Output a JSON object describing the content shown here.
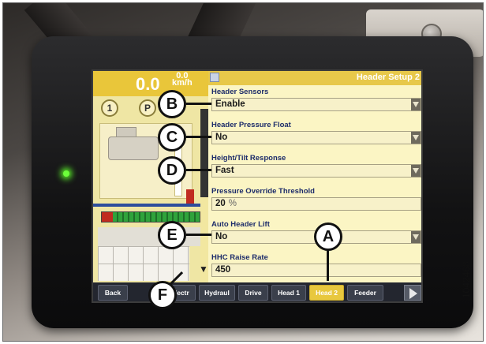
{
  "screen": {
    "title": "Header Setup 2",
    "speed": {
      "value": "0.0",
      "secondary": "0.0",
      "unit": "km/h"
    },
    "gear": {
      "left": "1",
      "right": "P"
    },
    "settings": [
      {
        "label": "Header Sensors",
        "value": "Enable",
        "dropdown": true
      },
      {
        "label": "Header Pressure Float",
        "value": "No",
        "dropdown": true
      },
      {
        "label": "Height/Tilt Response",
        "value": "Fast",
        "dropdown": true
      },
      {
        "label": "Pressure Override Threshold",
        "value": "20",
        "unit": "%",
        "dropdown": false
      },
      {
        "label": "Auto Header Lift",
        "value": "No",
        "dropdown": true
      },
      {
        "label": "HHC Raise Rate",
        "value": "450",
        "dropdown": false
      }
    ],
    "tabs": [
      {
        "label": "Back"
      },
      {
        "label": "Electr"
      },
      {
        "label": "Hydraul"
      },
      {
        "label": "Drive"
      },
      {
        "label": "Head 1"
      },
      {
        "label": "Head 2",
        "active": true
      },
      {
        "label": "Feeder"
      }
    ],
    "combine_label": "1"
  },
  "callouts": [
    "A",
    "B",
    "C",
    "D",
    "E",
    "F"
  ],
  "figure_id": "1042468",
  "colors": {
    "accent": "#e8c83e",
    "label_text": "#1d2c6a",
    "led": "#6cff3a"
  }
}
